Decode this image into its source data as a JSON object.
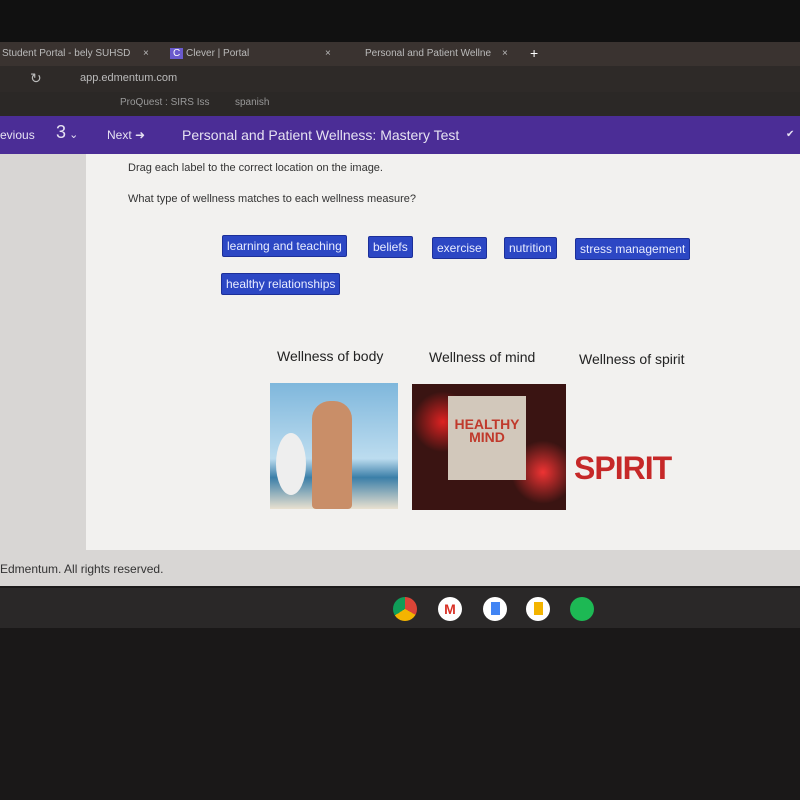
{
  "browser": {
    "tabs": [
      {
        "title": "Student Portal - bely SUHSD"
      },
      {
        "title": "Clever | Portal"
      },
      {
        "title": "Personal and Patient Wellne"
      }
    ],
    "new_tab": "+",
    "close": "×",
    "url": "app.edmentum.com",
    "bookmarks": [
      "ProQuest : SIRS Iss",
      "spanish"
    ]
  },
  "nav": {
    "previous": "Previous",
    "question_number": "3",
    "next": "Next",
    "title": "Personal and Patient Wellness: Mastery Test"
  },
  "question": {
    "instruction": "Drag each label to the correct location on the image.",
    "prompt": "What type of wellness matches to each wellness measure?"
  },
  "labels": [
    "learning and teaching",
    "beliefs",
    "exercise",
    "nutrition",
    "stress management",
    "healthy relationships"
  ],
  "targets": [
    {
      "heading": "Wellness of body"
    },
    {
      "heading": "Wellness of mind",
      "image_text": "HEALTHY MIND"
    },
    {
      "heading": "Wellness of spirit",
      "image_text": "SPIRIT"
    }
  ],
  "footer": "Edmentum. All rights reserved.",
  "colors": {
    "nav": "#4b2d96",
    "label": "#2c47c4"
  }
}
